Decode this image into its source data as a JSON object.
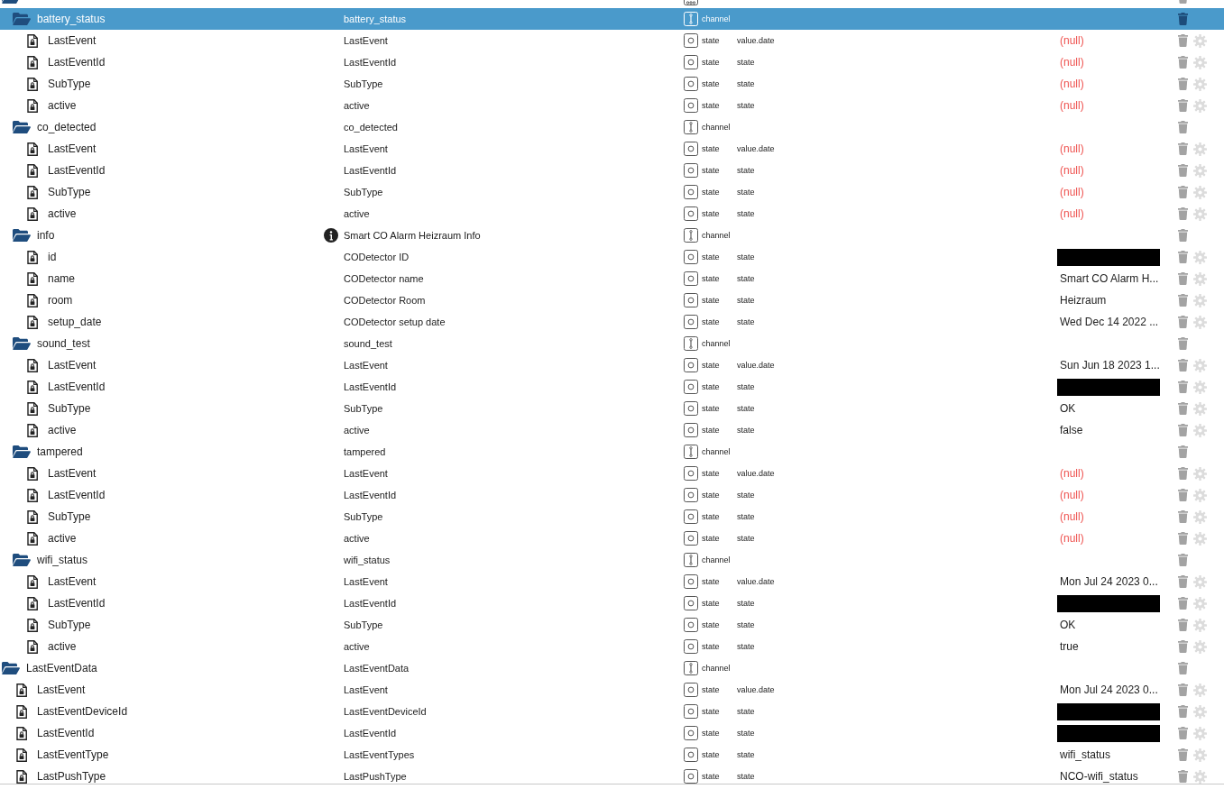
{
  "tree": [
    {
      "kind": "device",
      "selected": false,
      "expanded": true,
      "info": false,
      "children": [
        {
          "kind": "channel",
          "label": "battery_status",
          "name": "battery_status",
          "type": "channel",
          "selected": true,
          "expanded": true,
          "info": false,
          "children": [
            {
              "kind": "state",
              "label": "LastEvent",
              "name": "LastEvent",
              "type": "state",
              "role": "value.date",
              "value": "(null)",
              "is_null": true,
              "redacted": false,
              "selected": false,
              "info": false
            },
            {
              "kind": "state",
              "label": "LastEventId",
              "name": "LastEventId",
              "type": "state",
              "role": "state",
              "value": "(null)",
              "is_null": true,
              "redacted": false,
              "selected": false,
              "info": false
            },
            {
              "kind": "state",
              "label": "SubType",
              "name": "SubType",
              "type": "state",
              "role": "state",
              "value": "(null)",
              "is_null": true,
              "redacted": false,
              "selected": false,
              "info": false
            },
            {
              "kind": "state",
              "label": "active",
              "name": "active",
              "type": "state",
              "role": "state",
              "value": "(null)",
              "is_null": true,
              "redacted": false,
              "selected": false,
              "info": false
            }
          ]
        },
        {
          "kind": "channel",
          "label": "co_detected",
          "name": "co_detected",
          "type": "channel",
          "selected": false,
          "expanded": true,
          "info": false,
          "children": [
            {
              "kind": "state",
              "label": "LastEvent",
              "name": "LastEvent",
              "type": "state",
              "role": "value.date",
              "value": "(null)",
              "is_null": true,
              "redacted": false,
              "selected": false,
              "info": false
            },
            {
              "kind": "state",
              "label": "LastEventId",
              "name": "LastEventId",
              "type": "state",
              "role": "state",
              "value": "(null)",
              "is_null": true,
              "redacted": false,
              "selected": false,
              "info": false
            },
            {
              "kind": "state",
              "label": "SubType",
              "name": "SubType",
              "type": "state",
              "role": "state",
              "value": "(null)",
              "is_null": true,
              "redacted": false,
              "selected": false,
              "info": false
            },
            {
              "kind": "state",
              "label": "active",
              "name": "active",
              "type": "state",
              "role": "state",
              "value": "(null)",
              "is_null": true,
              "redacted": false,
              "selected": false,
              "info": false
            }
          ]
        },
        {
          "kind": "channel",
          "label": "info",
          "name": "Smart CO Alarm Heizraum Info",
          "type": "channel",
          "selected": false,
          "expanded": true,
          "info": true,
          "children": [
            {
              "kind": "state",
              "label": "id",
              "name": "CODetector ID",
              "type": "state",
              "role": "state",
              "redacted": true,
              "selected": false,
              "info": false
            },
            {
              "kind": "state",
              "label": "name",
              "name": "CODetector name",
              "type": "state",
              "role": "state",
              "value": "Smart CO Alarm H...",
              "is_null": false,
              "redacted": false,
              "selected": false,
              "info": false
            },
            {
              "kind": "state",
              "label": "room",
              "name": "CODetector Room",
              "type": "state",
              "role": "state",
              "value": "Heizraum",
              "is_null": false,
              "redacted": false,
              "selected": false,
              "info": false
            },
            {
              "kind": "state",
              "label": "setup_date",
              "name": "CODetector setup date",
              "type": "state",
              "role": "state",
              "value": "Wed Dec 14 2022 ...",
              "is_null": false,
              "redacted": false,
              "selected": false,
              "info": false
            }
          ]
        },
        {
          "kind": "channel",
          "label": "sound_test",
          "name": "sound_test",
          "type": "channel",
          "selected": false,
          "expanded": true,
          "info": false,
          "children": [
            {
              "kind": "state",
              "label": "LastEvent",
              "name": "LastEvent",
              "type": "state",
              "role": "value.date",
              "value": "Sun Jun 18 2023 1...",
              "is_null": false,
              "redacted": false,
              "selected": false,
              "info": false
            },
            {
              "kind": "state",
              "label": "LastEventId",
              "name": "LastEventId",
              "type": "state",
              "role": "state",
              "redacted": true,
              "selected": false,
              "info": false
            },
            {
              "kind": "state",
              "label": "SubType",
              "name": "SubType",
              "type": "state",
              "role": "state",
              "value": "OK",
              "is_null": false,
              "redacted": false,
              "selected": false,
              "info": false
            },
            {
              "kind": "state",
              "label": "active",
              "name": "active",
              "type": "state",
              "role": "state",
              "value": "false",
              "is_null": false,
              "redacted": false,
              "selected": false,
              "info": false
            }
          ]
        },
        {
          "kind": "channel",
          "label": "tampered",
          "name": "tampered",
          "type": "channel",
          "selected": false,
          "expanded": true,
          "info": false,
          "children": [
            {
              "kind": "state",
              "label": "LastEvent",
              "name": "LastEvent",
              "type": "state",
              "role": "value.date",
              "value": "(null)",
              "is_null": true,
              "redacted": false,
              "selected": false,
              "info": false
            },
            {
              "kind": "state",
              "label": "LastEventId",
              "name": "LastEventId",
              "type": "state",
              "role": "state",
              "value": "(null)",
              "is_null": true,
              "redacted": false,
              "selected": false,
              "info": false
            },
            {
              "kind": "state",
              "label": "SubType",
              "name": "SubType",
              "type": "state",
              "role": "state",
              "value": "(null)",
              "is_null": true,
              "redacted": false,
              "selected": false,
              "info": false
            },
            {
              "kind": "state",
              "label": "active",
              "name": "active",
              "type": "state",
              "role": "state",
              "value": "(null)",
              "is_null": true,
              "redacted": false,
              "selected": false,
              "info": false
            }
          ]
        },
        {
          "kind": "channel",
          "label": "wifi_status",
          "name": "wifi_status",
          "type": "channel",
          "selected": false,
          "expanded": true,
          "info": false,
          "children": [
            {
              "kind": "state",
              "label": "LastEvent",
              "name": "LastEvent",
              "type": "state",
              "role": "value.date",
              "value": "Mon Jul 24 2023 0...",
              "is_null": false,
              "redacted": false,
              "selected": false,
              "info": false
            },
            {
              "kind": "state",
              "label": "LastEventId",
              "name": "LastEventId",
              "type": "state",
              "role": "state",
              "redacted": true,
              "selected": false,
              "info": false
            },
            {
              "kind": "state",
              "label": "SubType",
              "name": "SubType",
              "type": "state",
              "role": "state",
              "value": "OK",
              "is_null": false,
              "redacted": false,
              "selected": false,
              "info": false
            },
            {
              "kind": "state",
              "label": "active",
              "name": "active",
              "type": "state",
              "role": "state",
              "value": "true",
              "is_null": false,
              "redacted": false,
              "selected": false,
              "info": false
            }
          ]
        }
      ]
    },
    {
      "kind": "channel",
      "label": "LastEventData",
      "name": "LastEventData",
      "type": "channel",
      "selected": false,
      "expanded": true,
      "info": false,
      "children": [
        {
          "kind": "state",
          "label": "LastEvent",
          "name": "LastEvent",
          "type": "state",
          "role": "value.date",
          "value": "Mon Jul 24 2023 0...",
          "is_null": false,
          "redacted": false,
          "selected": false,
          "info": false
        },
        {
          "kind": "state",
          "label": "LastEventDeviceId",
          "name": "LastEventDeviceId",
          "type": "state",
          "role": "state",
          "redacted": true,
          "selected": false,
          "info": false
        },
        {
          "kind": "state",
          "label": "LastEventId",
          "name": "LastEventId",
          "type": "state",
          "role": "state",
          "redacted": true,
          "selected": false,
          "info": false
        },
        {
          "kind": "state",
          "label": "LastEventType",
          "name": "LastEventTypes",
          "type": "state",
          "role": "state",
          "value": "wifi_status",
          "is_null": false,
          "redacted": false,
          "selected": false,
          "info": false
        },
        {
          "kind": "state",
          "label": "LastPushType",
          "name": "LastPushType",
          "type": "state",
          "role": "state",
          "value": "NCO-wifi_status",
          "is_null": false,
          "redacted": false,
          "selected": false,
          "info": false
        }
      ]
    }
  ]
}
